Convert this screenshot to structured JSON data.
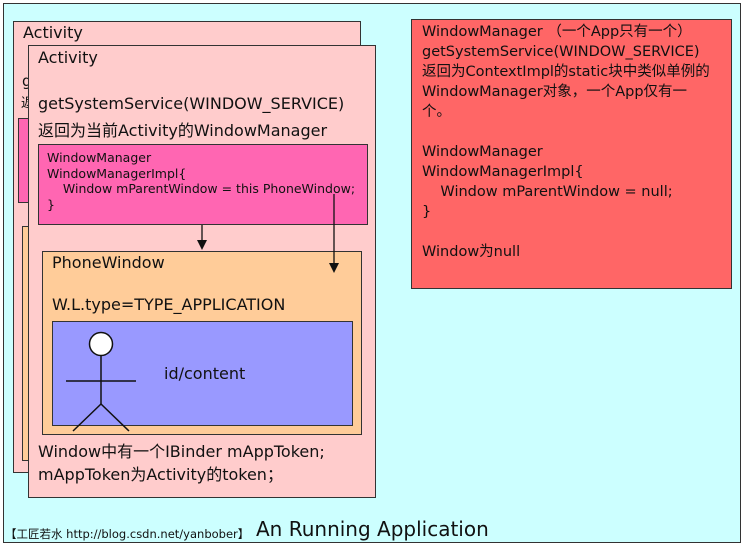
{
  "activity_back": {
    "title": "Activity",
    "peek_chars": [
      "g",
      "返"
    ]
  },
  "activity_front": {
    "title": "Activity",
    "get_service_line1": "getSystemService(WINDOW_SERVICE)",
    "get_service_line2": "返回为当前Activity的WindowManager",
    "token_line1": "Window中有一个IBinder mAppToken;",
    "token_line2": "mAppToken为Activity的token；"
  },
  "activity_window_manager": {
    "lines": [
      "WindowManager",
      "WindowManagerImpl{",
      "    Window mParentWindow = this PhoneWindow;",
      "}"
    ]
  },
  "phone_window": {
    "title": "PhoneWindow",
    "type_line": "W.L.type=TYPE_APPLICATION",
    "content_label": "id/content"
  },
  "global_window_manager": {
    "lines": [
      "WindowManager （一个App只有一个）",
      "",
      "getSystemService(WINDOW_SERVICE)",
      "返回为ContextImpl的static块中类似单例的",
      "WindowManager对象，一个App仅有一",
      "个。",
      "",
      "WindowManager",
      "WindowManagerImpl{",
      "    Window mParentWindow = null;",
      "}",
      "",
      "Window为null"
    ]
  },
  "watermark": "【工匠若水 http://blog.csdn.net/yanbober】",
  "caption": "An Running Application",
  "colors": {
    "background": "#ccffff",
    "activity": "#ffcccc",
    "window_manager_local": "#ff66b2",
    "phone_window": "#ffcc99",
    "content": "#9999ff",
    "window_manager_global": "#ff6666"
  },
  "icons": {
    "content_figure": "stick-figure-icon"
  }
}
